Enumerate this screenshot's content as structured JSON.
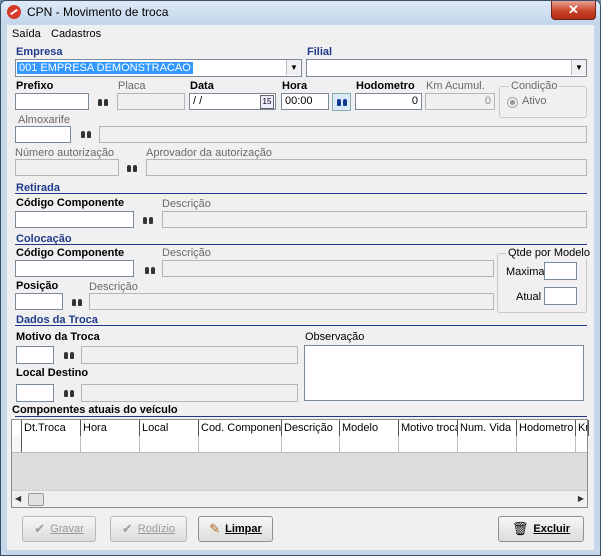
{
  "window": {
    "title": "CPN - Movimento de troca",
    "close": "✕"
  },
  "menu": {
    "items": [
      "Saída",
      "Cadastros"
    ]
  },
  "empresa": {
    "label": "Empresa",
    "value": "001 EMPRESA DEMONSTRACAO"
  },
  "filial": {
    "label": "Filial",
    "value": ""
  },
  "prefixo": {
    "label": "Prefixo",
    "value": ""
  },
  "placa": {
    "label": "Placa",
    "value": ""
  },
  "data": {
    "label": "Data",
    "value": " / /",
    "calendar_day": "15"
  },
  "hora": {
    "label": "Hora",
    "value": "00:00"
  },
  "hodometro": {
    "label": "Hodometro",
    "value": "0"
  },
  "km_acumul": {
    "label": "Km Acumul.",
    "value": "0"
  },
  "condicao": {
    "label": "Condição",
    "option": "Ativo"
  },
  "almoxarife": {
    "label": "Almoxarife",
    "value": ""
  },
  "numero_autorizacao": {
    "label": "Número autorização",
    "value": ""
  },
  "aprovador": {
    "label": "Aprovador da autorização",
    "value": ""
  },
  "retirada": {
    "title": "Retirada",
    "codigo_label": "Código Componente",
    "descricao_label": "Descrição"
  },
  "colocacao": {
    "title": "Colocação",
    "codigo_label": "Código Componente",
    "descricao_label": "Descrição",
    "posicao_label": "Posição",
    "posicao_descricao_label": "Descrição"
  },
  "qtde": {
    "label": "Qtde por Modelo",
    "maxima_label": "Maxima",
    "atual_label": "Atual"
  },
  "dados_troca": {
    "title": "Dados da Troca",
    "motivo_label": "Motivo da Troca",
    "local_label": "Local Destino",
    "observacao_label": "Observação"
  },
  "componentes": {
    "title": "Componentes atuais do veículo",
    "columns": [
      "Dt.Troca",
      "Hora",
      "Local",
      "Cod. Componente",
      "Descrição",
      "Modelo",
      "Motivo troca",
      "Num. Vida",
      "Hodometro V",
      "Km"
    ]
  },
  "buttons": {
    "gravar": "Gravar",
    "rodizio": "Rodízio",
    "limpar": "Limpar",
    "excluir": "Excluir"
  }
}
